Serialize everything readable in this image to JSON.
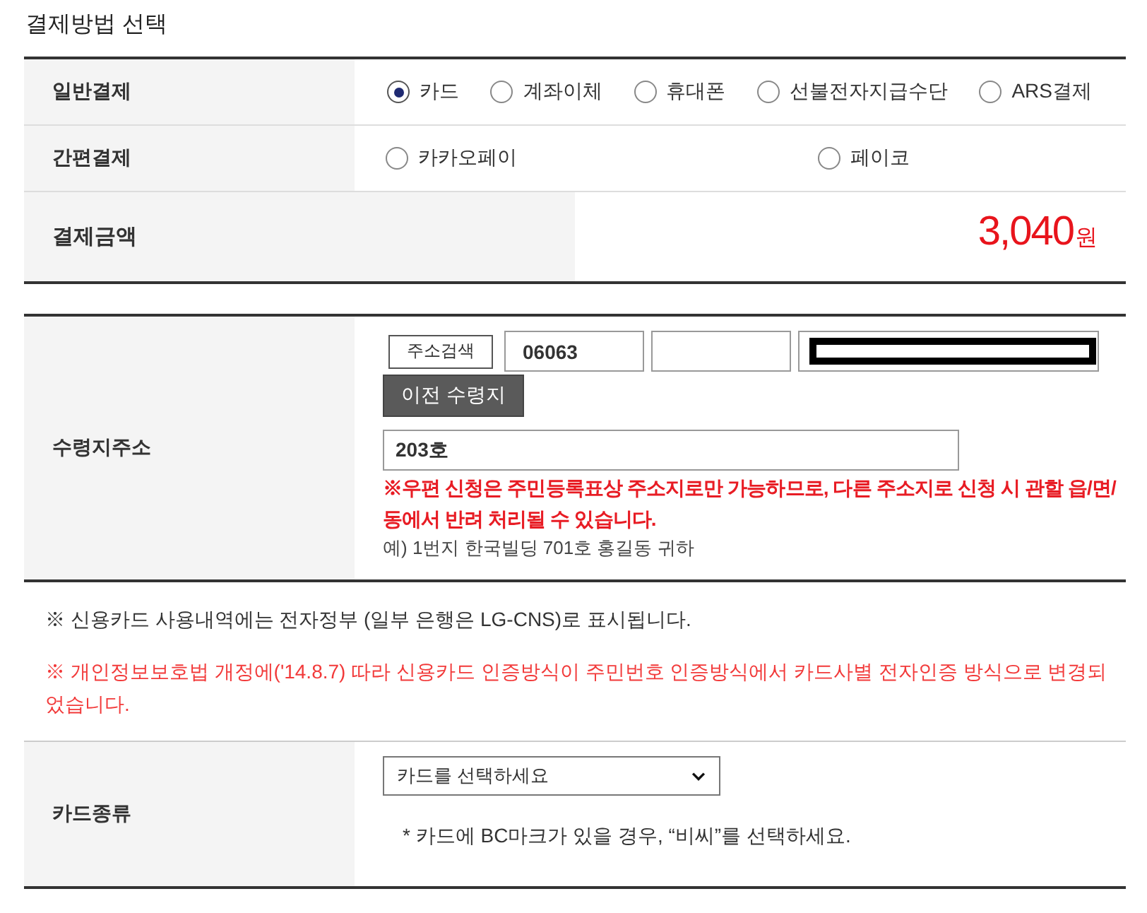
{
  "title": "결제방법 선택",
  "payment_table": {
    "rows": [
      {
        "kind": "radio-row",
        "label": "일반결제",
        "options": [
          {
            "label": "카드",
            "selected": true
          },
          {
            "label": "계좌이체",
            "selected": false
          },
          {
            "label": "휴대폰",
            "selected": false
          },
          {
            "label": "선불전자지급수단",
            "selected": false
          },
          {
            "label": "ARS결제",
            "selected": false
          }
        ]
      },
      {
        "kind": "radio-columns",
        "label": "간편결제",
        "options": [
          {
            "label": "카카오페이",
            "selected": false
          },
          {
            "label": "페이코",
            "selected": false
          }
        ]
      },
      {
        "kind": "amount",
        "label": "결제금액",
        "amount": "3,040",
        "unit": "원"
      }
    ]
  },
  "address": {
    "label": "수령지주소",
    "search_button": "주소검색",
    "fields": [
      {
        "value": "06063",
        "redacted": false
      },
      {
        "redacted": false
      },
      {
        "redacted": true
      }
    ],
    "previous_button": "이전 수령지",
    "detail": {
      "value": "203호"
    },
    "warning": "※우편 신청은 주민등록표상 주소지로만 가능하므로, 다른 주소지로 신청 시 관할 읍/면/동에서 반려 처리될 수 있습니다.",
    "example": "예) 1번지 한국빌딩 701호 홍길동 귀하"
  },
  "notices": [
    {
      "kind": "info",
      "text": "※ 신용카드 사용내역에는 전자정부 (일부 은행은 LG-CNS)로 표시됩니다."
    },
    {
      "kind": "warning",
      "text": "※ 개인정보보호법 개정에('14.8.7) 따라 신용카드 인증방식이 주민번호 인증방식에서 카드사별 전자인증 방식으로 변경되었습니다."
    }
  ],
  "card_type": {
    "label": "카드종류",
    "select": {
      "value": "카드를 선택하세요"
    },
    "hint": "* 카드에 BC마크가 있을 경우, “비씨”를 선택하세요."
  }
}
